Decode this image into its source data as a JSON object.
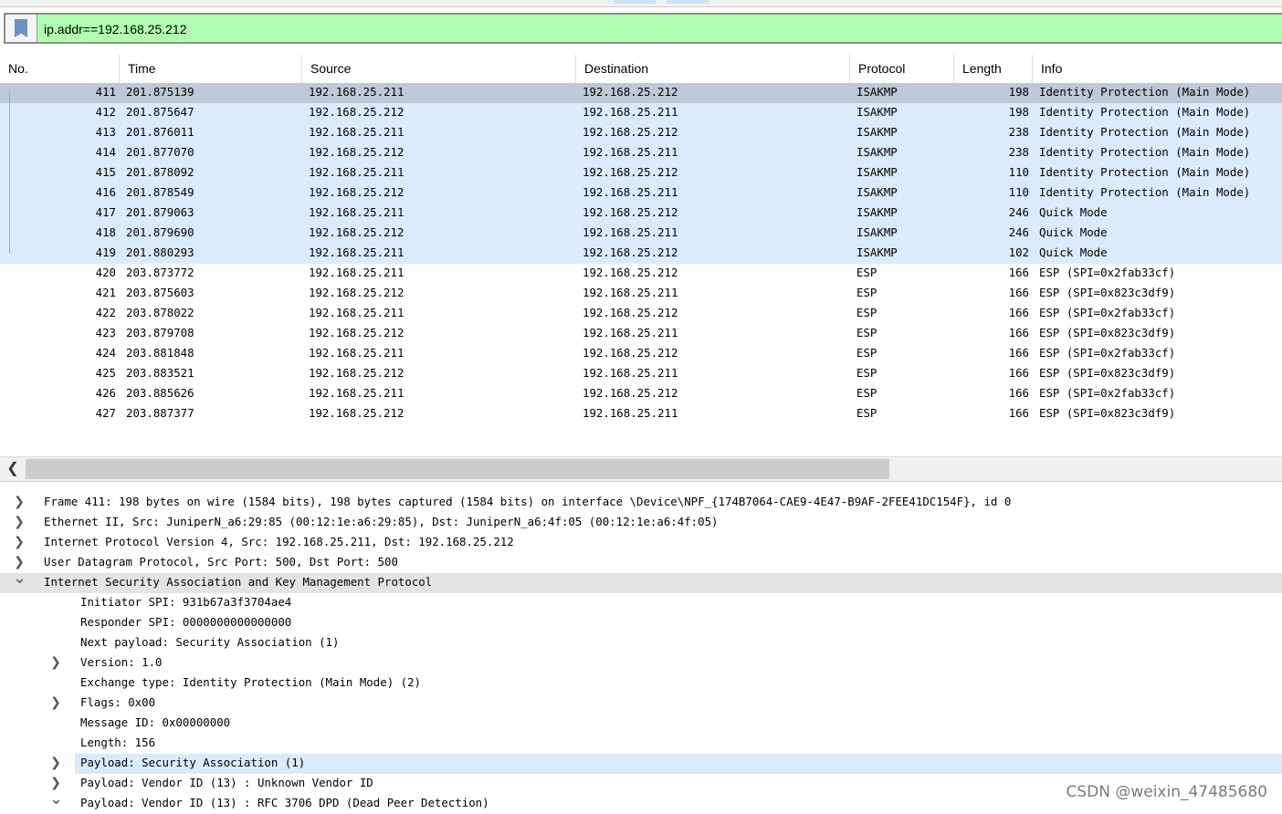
{
  "filter": {
    "text": "ip.addr==192.168.25.212"
  },
  "columns": [
    "No.",
    "Time",
    "Source",
    "Destination",
    "Protocol",
    "Length",
    "Info"
  ],
  "packets": [
    {
      "no": "411",
      "time": "201.875139",
      "src": "192.168.25.211",
      "dst": "192.168.25.212",
      "proto": "ISAKMP",
      "len": "198",
      "info": "Identity Protection (Main Mode)"
    },
    {
      "no": "412",
      "time": "201.875647",
      "src": "192.168.25.212",
      "dst": "192.168.25.211",
      "proto": "ISAKMP",
      "len": "198",
      "info": "Identity Protection (Main Mode)"
    },
    {
      "no": "413",
      "time": "201.876011",
      "src": "192.168.25.211",
      "dst": "192.168.25.212",
      "proto": "ISAKMP",
      "len": "238",
      "info": "Identity Protection (Main Mode)"
    },
    {
      "no": "414",
      "time": "201.877070",
      "src": "192.168.25.212",
      "dst": "192.168.25.211",
      "proto": "ISAKMP",
      "len": "238",
      "info": "Identity Protection (Main Mode)"
    },
    {
      "no": "415",
      "time": "201.878092",
      "src": "192.168.25.211",
      "dst": "192.168.25.212",
      "proto": "ISAKMP",
      "len": "110",
      "info": "Identity Protection (Main Mode)"
    },
    {
      "no": "416",
      "time": "201.878549",
      "src": "192.168.25.212",
      "dst": "192.168.25.211",
      "proto": "ISAKMP",
      "len": "110",
      "info": "Identity Protection (Main Mode)"
    },
    {
      "no": "417",
      "time": "201.879063",
      "src": "192.168.25.211",
      "dst": "192.168.25.212",
      "proto": "ISAKMP",
      "len": "246",
      "info": "Quick Mode"
    },
    {
      "no": "418",
      "time": "201.879690",
      "src": "192.168.25.212",
      "dst": "192.168.25.211",
      "proto": "ISAKMP",
      "len": "246",
      "info": "Quick Mode"
    },
    {
      "no": "419",
      "time": "201.880293",
      "src": "192.168.25.211",
      "dst": "192.168.25.212",
      "proto": "ISAKMP",
      "len": "102",
      "info": "Quick Mode"
    },
    {
      "no": "420",
      "time": "203.873772",
      "src": "192.168.25.211",
      "dst": "192.168.25.212",
      "proto": "ESP",
      "len": "166",
      "info": "ESP (SPI=0x2fab33cf)"
    },
    {
      "no": "421",
      "time": "203.875603",
      "src": "192.168.25.212",
      "dst": "192.168.25.211",
      "proto": "ESP",
      "len": "166",
      "info": "ESP (SPI=0x823c3df9)"
    },
    {
      "no": "422",
      "time": "203.878022",
      "src": "192.168.25.211",
      "dst": "192.168.25.212",
      "proto": "ESP",
      "len": "166",
      "info": "ESP (SPI=0x2fab33cf)"
    },
    {
      "no": "423",
      "time": "203.879708",
      "src": "192.168.25.212",
      "dst": "192.168.25.211",
      "proto": "ESP",
      "len": "166",
      "info": "ESP (SPI=0x823c3df9)"
    },
    {
      "no": "424",
      "time": "203.881848",
      "src": "192.168.25.211",
      "dst": "192.168.25.212",
      "proto": "ESP",
      "len": "166",
      "info": "ESP (SPI=0x2fab33cf)"
    },
    {
      "no": "425",
      "time": "203.883521",
      "src": "192.168.25.212",
      "dst": "192.168.25.211",
      "proto": "ESP",
      "len": "166",
      "info": "ESP (SPI=0x823c3df9)"
    },
    {
      "no": "426",
      "time": "203.885626",
      "src": "192.168.25.211",
      "dst": "192.168.25.212",
      "proto": "ESP",
      "len": "166",
      "info": "ESP (SPI=0x2fab33cf)"
    },
    {
      "no": "427",
      "time": "203.887377",
      "src": "192.168.25.212",
      "dst": "192.168.25.211",
      "proto": "ESP",
      "len": "166",
      "info": "ESP (SPI=0x823c3df9)"
    }
  ],
  "details": [
    {
      "text": "Frame 411: 198 bytes on wire (1584 bits), 198 bytes captured (1584 bits) on interface \\Device\\NPF_{174B7064-CAE9-4E47-B9AF-2FEE41DC154F}, id 0",
      "expander": "collapsed"
    },
    {
      "text": "Ethernet II, Src: JuniperN_a6:29:85 (00:12:1e:a6:29:85), Dst: JuniperN_a6:4f:05 (00:12:1e:a6:4f:05)",
      "expander": "collapsed"
    },
    {
      "text": "Internet Protocol Version 4, Src: 192.168.25.211, Dst: 192.168.25.212",
      "expander": "collapsed"
    },
    {
      "text": "User Datagram Protocol, Src Port: 500, Dst Port: 500",
      "expander": "collapsed"
    },
    {
      "text": "Internet Security Association and Key Management Protocol",
      "expander": "expanded"
    },
    {
      "text": "Initiator SPI: 931b67a3f3704ae4",
      "expander": "none"
    },
    {
      "text": "Responder SPI: 0000000000000000",
      "expander": "none"
    },
    {
      "text": "Next payload: Security Association (1)",
      "expander": "none"
    },
    {
      "text": "Version: 1.0",
      "expander": "collapsed"
    },
    {
      "text": "Exchange type: Identity Protection (Main Mode) (2)",
      "expander": "none"
    },
    {
      "text": "Flags: 0x00",
      "expander": "collapsed"
    },
    {
      "text": "Message ID: 0x00000000",
      "expander": "none"
    },
    {
      "text": "Length: 156",
      "expander": "none"
    },
    {
      "text": "Payload: Security Association (1)",
      "expander": "collapsed"
    },
    {
      "text": "Payload: Vendor ID (13) : Unknown Vendor ID",
      "expander": "collapsed"
    },
    {
      "text": "Payload: Vendor ID (13) : RFC 3706 DPD (Dead Peer Detection)",
      "expander": "expanded"
    }
  ],
  "watermark": "CSDN @weixin_47485680",
  "colors": {
    "filter_valid_bg": "#afffaf",
    "selected_row_bg": "#bcc9d6",
    "related_row_bg": "#daebfb"
  }
}
